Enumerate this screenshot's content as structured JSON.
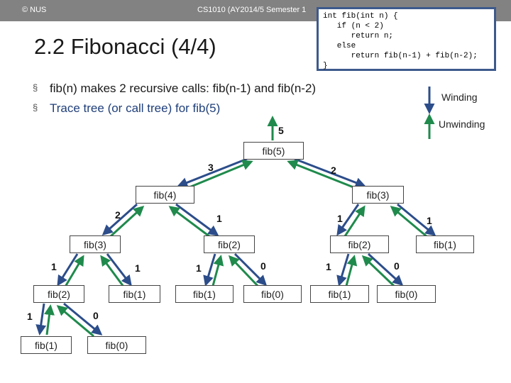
{
  "header": {
    "left": "© NUS",
    "center": "CS1010 (AY2014/5 Semester 1"
  },
  "slide": {
    "title": "2.2 Fibonacci (4/4)",
    "bullets": [
      "fib(n) makes 2 recursive calls: fib(n-1) and fib(n-2)",
      "Trace tree (or call tree) for fib(5)"
    ]
  },
  "code": [
    "int fib(int n) {",
    "   if (n < 2)",
    "      return n;",
    "   else",
    "      return fib(n-1) + fib(n-2);",
    "}"
  ],
  "legend": {
    "winding": "Winding",
    "unwinding": "Unwinding"
  },
  "colors": {
    "header": "#828282",
    "winding": "#2c4d8a",
    "unwinding": "#1f8a4c",
    "code_border": "#3d5a8c",
    "bullet_blue": "#1f3f7a"
  },
  "tree": {
    "root_value": "5",
    "nodes": {
      "n5": "fib(5)",
      "n4": "fib(4)",
      "n3r": "fib(3)",
      "n3": "fib(3)",
      "n2a": "fib(2)",
      "n2b": "fib(2)",
      "n1a": "fib(1)",
      "n2c": "fib(2)",
      "n1b": "fib(1)",
      "n1c": "fib(1)",
      "n0a": "fib(0)",
      "n1d": "fib(1)",
      "n0b": "fib(0)",
      "n1e": "fib(1)",
      "n0c": "fib(0)"
    },
    "values": {
      "v4": "3",
      "v3r": "2",
      "v3": "2",
      "v2a": "1",
      "v2b": "1",
      "v1a": "1",
      "v2c": "1",
      "v1b": "1",
      "v1c": "1",
      "v0a": "0",
      "v1d": "1",
      "v0b": "0",
      "v1e": "1",
      "v0c": "0"
    }
  }
}
